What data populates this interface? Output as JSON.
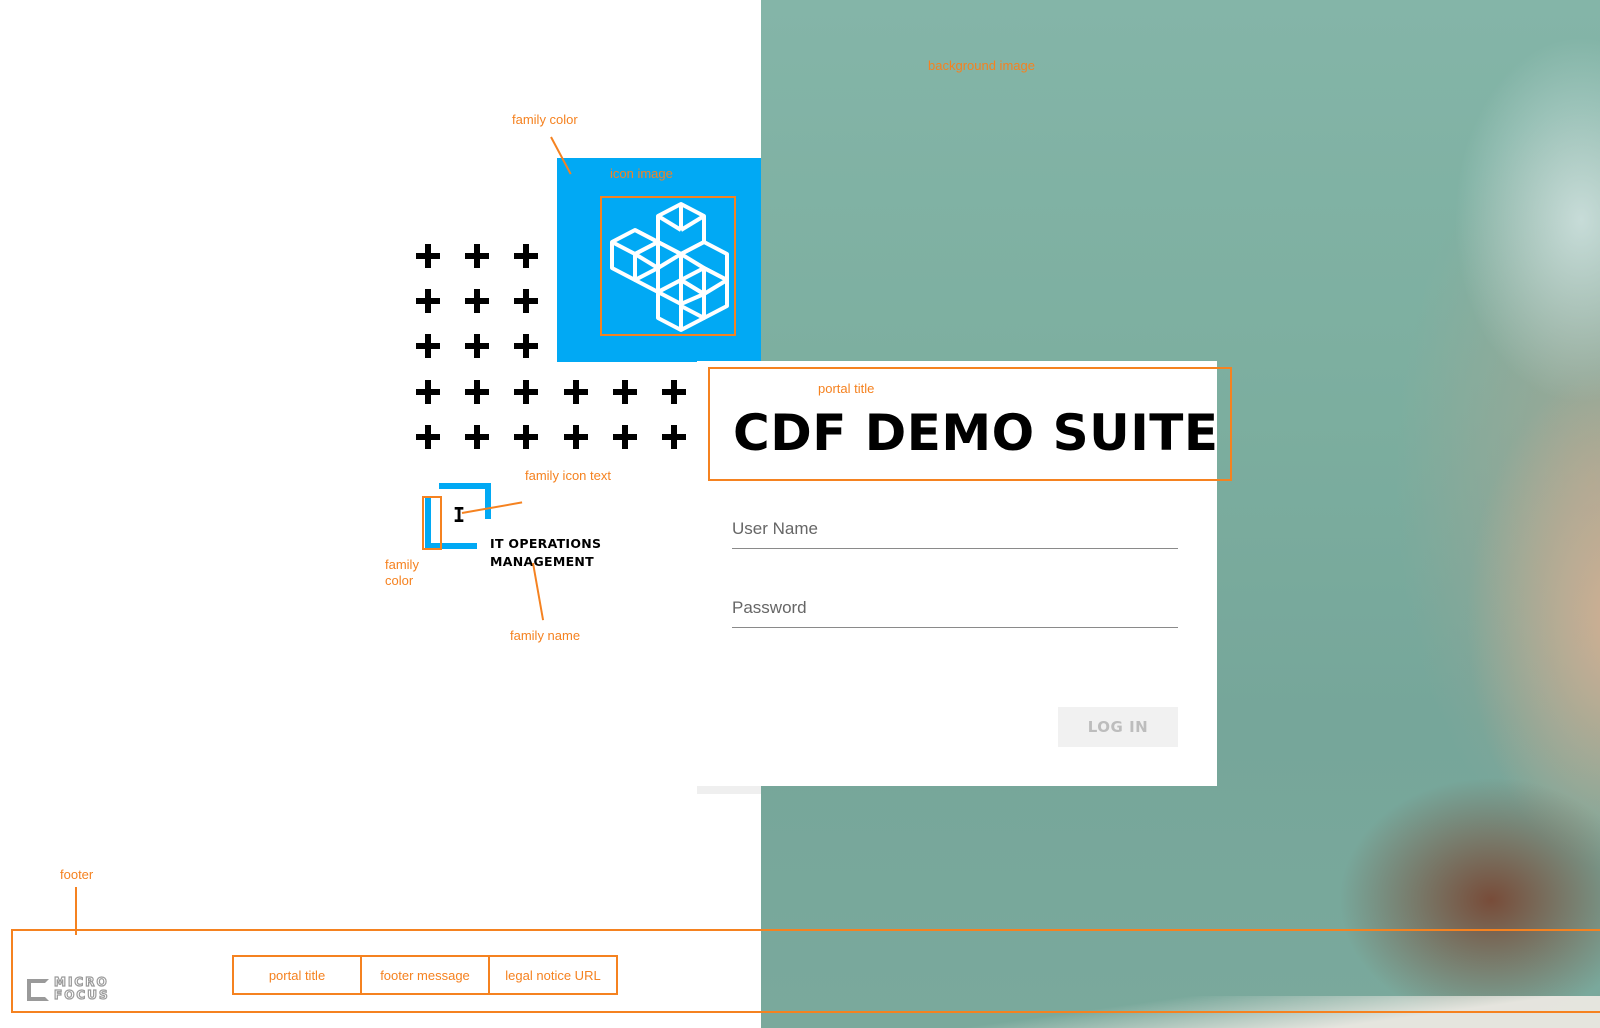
{
  "annotations": {
    "background_image": "background image",
    "family_color_top": "family color",
    "icon_image": "icon image",
    "portal_title": "portal title",
    "family_icon_text": "family icon text",
    "family_color_left": "family\ncolor",
    "family_name": "family name",
    "footer": "footer"
  },
  "brand": {
    "family_name_line1": "IT OPERATIONS",
    "family_name_line2": "MANAGEMENT",
    "family_icon_text": "I",
    "family_color": "#01a9f4"
  },
  "login": {
    "portal_title": "CDF DEMO SUITE",
    "username_placeholder": "User Name",
    "password_placeholder": "Password",
    "login_label": "LOG IN"
  },
  "footer": {
    "logo_line1": "MICRO",
    "logo_line2": "FOCUS",
    "items": [
      "portal title",
      "footer message",
      "legal notice URL"
    ]
  },
  "colors": {
    "annotation": "#f58220",
    "family_tile": "#01a9f4"
  }
}
